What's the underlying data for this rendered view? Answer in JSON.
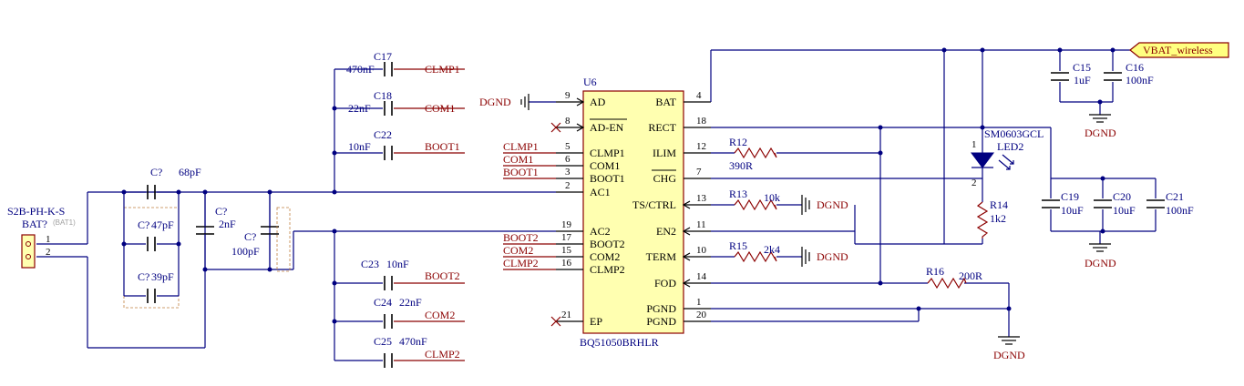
{
  "ic": {
    "ref": "U6",
    "part": "BQ51050BRHLR",
    "left_pins": [
      {
        "num": "9",
        "name": "AD"
      },
      {
        "num": "8",
        "name": "AD-EN"
      },
      {
        "num": "5",
        "name": "CLMP1"
      },
      {
        "num": "6",
        "name": "COM1"
      },
      {
        "num": "3",
        "name": "BOOT1"
      },
      {
        "num": "2",
        "name": "AC1"
      },
      {
        "num": "19",
        "name": "AC2"
      },
      {
        "num": "17",
        "name": "BOOT2"
      },
      {
        "num": "15",
        "name": "COM2"
      },
      {
        "num": "16",
        "name": "CLMP2"
      },
      {
        "num": "21",
        "name": "EP"
      }
    ],
    "right_pins": [
      {
        "num": "4",
        "name": "BAT"
      },
      {
        "num": "18",
        "name": "RECT"
      },
      {
        "num": "12",
        "name": "ILIM"
      },
      {
        "num": "7",
        "name": "CHG"
      },
      {
        "num": "13",
        "name": "TS/CTRL"
      },
      {
        "num": "11",
        "name": "EN2"
      },
      {
        "num": "10",
        "name": "TERM"
      },
      {
        "num": "14",
        "name": "FOD"
      },
      {
        "num": "1",
        "name": "PGND"
      },
      {
        "num": "20",
        "name": "PGND"
      }
    ]
  },
  "connector": {
    "ref": "BAT?",
    "ref_sub": "(BAT1)",
    "part": "S2B-PH-K-S",
    "pin1": "1",
    "pin2": "2"
  },
  "top_caps": [
    {
      "ref": "C17",
      "value": "470nF",
      "net": "CLMP1"
    },
    {
      "ref": "C18",
      "value": "22nF",
      "net": "COM1"
    },
    {
      "ref": "C22",
      "value": "10nF",
      "net": "BOOT1"
    }
  ],
  "bottom_caps": [
    {
      "ref": "C23",
      "value": "10nF",
      "net": "BOOT2"
    },
    {
      "ref": "C24",
      "value": "22nF",
      "net": "COM2"
    },
    {
      "ref": "C25",
      "value": "470nF",
      "net": "CLMP2"
    }
  ],
  "left_net_labels": [
    "CLMP1",
    "COM1",
    "BOOT1",
    "BOOT2",
    "COM2",
    "CLMP2"
  ],
  "dgnd_label": "DGND",
  "resonant": [
    {
      "ref": "C?",
      "value": "68pF"
    },
    {
      "ref": "C?",
      "value": "47pF"
    },
    {
      "ref": "C?",
      "value": "39pF"
    },
    {
      "ref": "C?",
      "value": "2nF"
    },
    {
      "ref": "C?",
      "value": "100pF"
    }
  ],
  "resistors": [
    {
      "ref": "R12",
      "value": "390R"
    },
    {
      "ref": "R13",
      "value": "10k"
    },
    {
      "ref": "R15",
      "value": "2k4"
    },
    {
      "ref": "R14",
      "value": "1k2"
    },
    {
      "ref": "R16",
      "value": "200R"
    }
  ],
  "led": {
    "part": "SM0603GCL",
    "ref": "LED2",
    "pin1": "1",
    "pin2": "2"
  },
  "power_port": "VBAT_wireless",
  "out_caps_top": [
    {
      "ref": "C15",
      "value": "1uF"
    },
    {
      "ref": "C16",
      "value": "100nF"
    }
  ],
  "out_caps_bottom": [
    {
      "ref": "C19",
      "value": "10uF"
    },
    {
      "ref": "C20",
      "value": "10uF"
    },
    {
      "ref": "C21",
      "value": "100nF"
    }
  ],
  "colors": {
    "wire": "#000080",
    "net": "#8b0000",
    "ic_fill": "#ffffb0",
    "power_fill": "#ffff80"
  }
}
